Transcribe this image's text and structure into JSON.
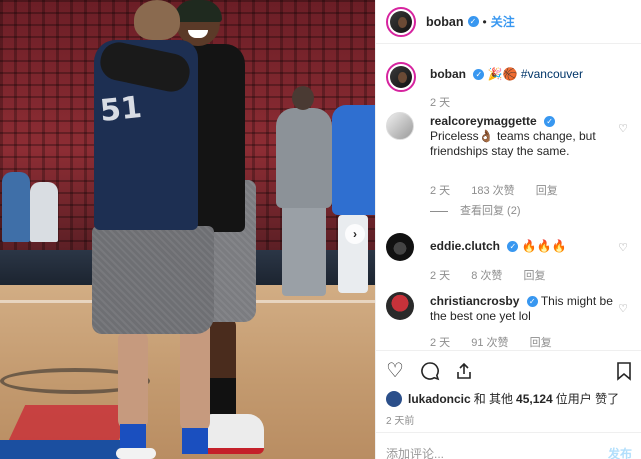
{
  "post": {
    "author": "boban",
    "follow_label": "关注",
    "separator": "•"
  },
  "caption": {
    "author": "boban",
    "emoji": "🎉🏀",
    "hashtag": "#vancouver",
    "time": "2 天"
  },
  "comments": [
    {
      "author": "realcoreymaggette",
      "text": "Priceless👌🏾 teams change, but friendships stay the same.",
      "time": "2 天",
      "likes": "183 次赞",
      "reply_label": "回复",
      "view_replies": "查看回复 (2)"
    },
    {
      "author": "eddie.clutch",
      "text": "🔥🔥🔥",
      "time": "2 天",
      "likes": "8 次赞",
      "reply_label": "回复"
    },
    {
      "author": "christiancrosby",
      "text": "This might be the best one yet lol",
      "time": "2 天",
      "likes": "91 次赞",
      "reply_label": "回复"
    }
  ],
  "likes_line": {
    "user": "lukadoncic",
    "middle": "和 其他",
    "count": "45,124",
    "suffix": "位用户 赞了"
  },
  "post_time": "2 天前",
  "add_comment": {
    "placeholder": "添加评论...",
    "post_label": "发布"
  },
  "icons": {
    "verified": "verified-badge-icon",
    "heart": "heart-icon",
    "comment": "comment-icon",
    "share": "share-icon",
    "save": "bookmark-icon",
    "carousel_next": "chevron-right-icon"
  },
  "colors": {
    "accent": "#3897f0",
    "story_ring": "#d6249f",
    "muted": "#8e8e8e"
  }
}
